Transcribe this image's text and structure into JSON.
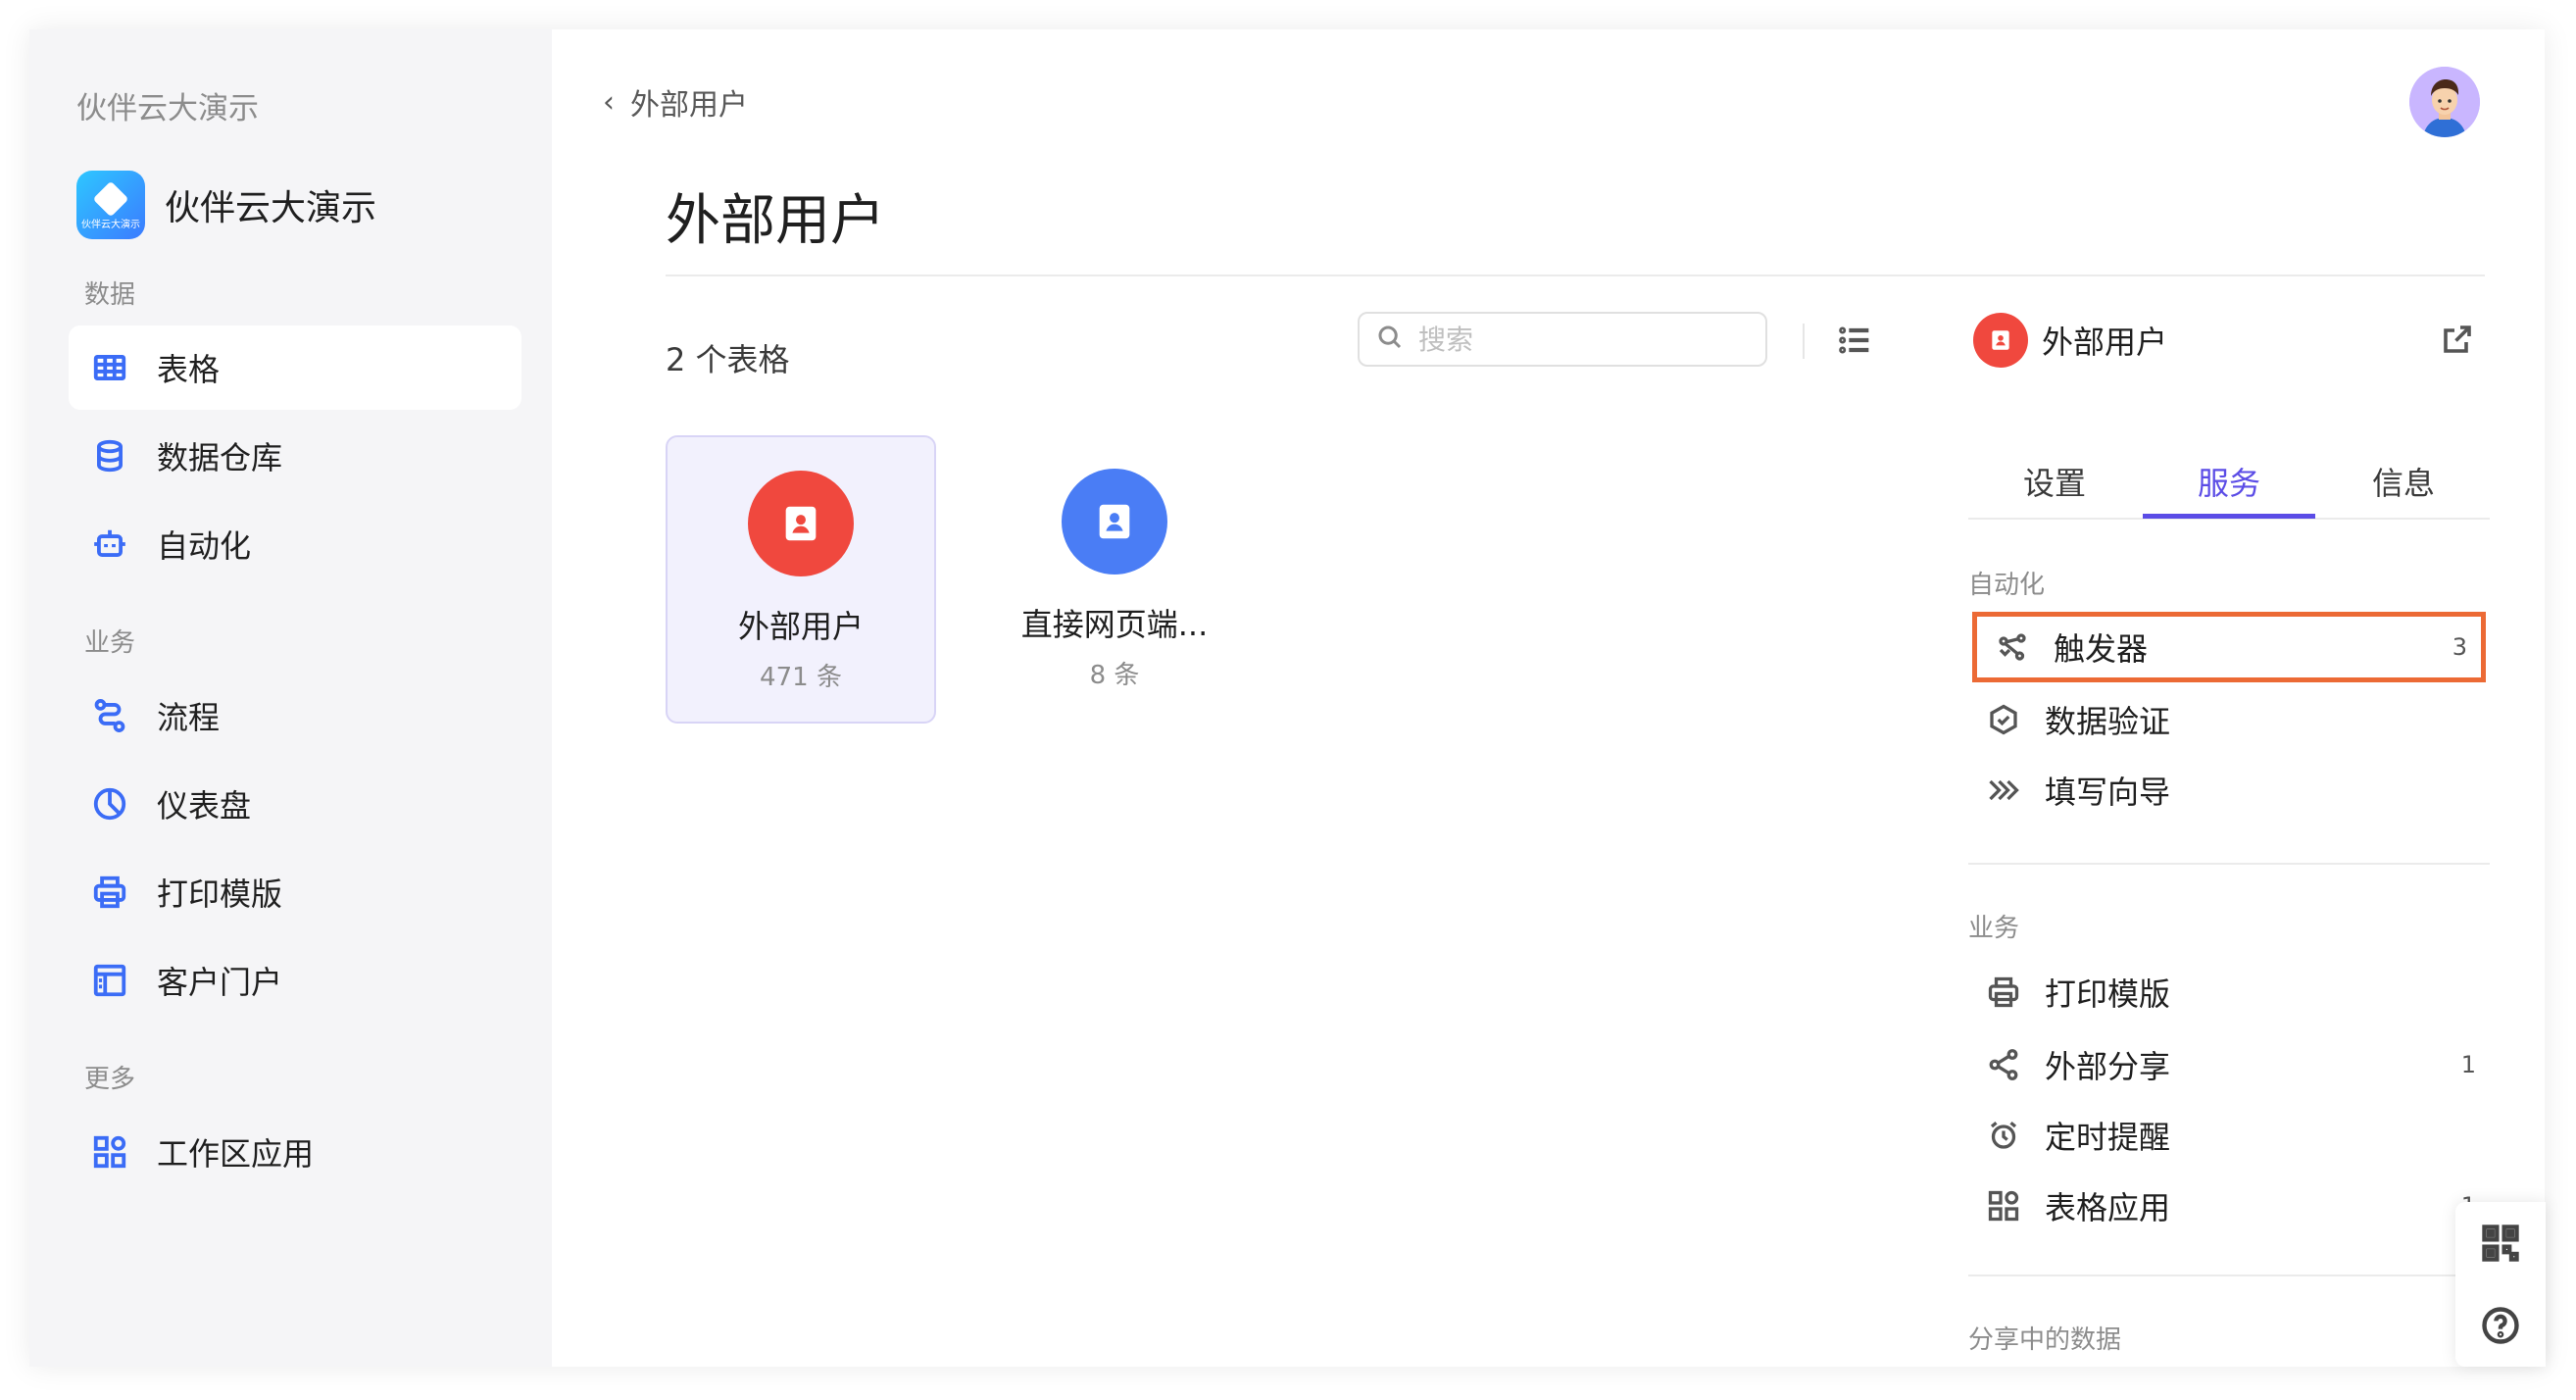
{
  "workspace_name": "伙伴云大演示",
  "app": {
    "name": "伙伴云大演示",
    "logo_text": "伙伴云大演示"
  },
  "sidebar": {
    "sections": [
      {
        "title": "数据",
        "items": [
          {
            "label": "表格",
            "icon": "table-icon",
            "active": true
          },
          {
            "label": "数据仓库",
            "icon": "database-icon"
          },
          {
            "label": "自动化",
            "icon": "robot-icon"
          }
        ]
      },
      {
        "title": "业务",
        "items": [
          {
            "label": "流程",
            "icon": "flow-icon"
          },
          {
            "label": "仪表盘",
            "icon": "pie-chart-icon"
          },
          {
            "label": "打印模版",
            "icon": "printer-icon"
          },
          {
            "label": "客户门户",
            "icon": "portal-icon"
          }
        ]
      },
      {
        "title": "更多",
        "items": [
          {
            "label": "工作区应用",
            "icon": "apps-icon"
          }
        ]
      }
    ]
  },
  "header": {
    "breadcrumb": "外部用户",
    "title": "外部用户"
  },
  "toolbar": {
    "count_label": "2 个表格",
    "search_placeholder": "搜索"
  },
  "tables": [
    {
      "name": "外部用户",
      "count": "471 条",
      "color": "#f0483e",
      "selected": true
    },
    {
      "name": "直接网页端...",
      "count": "8 条",
      "color": "#4a7df5",
      "selected": false
    }
  ],
  "panel": {
    "title": "外部用户",
    "tabs": [
      "设置",
      "服务",
      "信息"
    ],
    "active_tab": "服务",
    "automation": {
      "title": "自动化",
      "items": [
        {
          "label": "触发器",
          "count": "3",
          "icon": "trigger-icon",
          "highlighted": true
        },
        {
          "label": "数据验证",
          "count": "",
          "icon": "shield-check-icon"
        },
        {
          "label": "填写向导",
          "count": "",
          "icon": "guide-arrows-icon"
        }
      ]
    },
    "business": {
      "title": "业务",
      "items": [
        {
          "label": "打印模版",
          "count": "",
          "icon": "printer-icon"
        },
        {
          "label": "外部分享",
          "count": "1",
          "icon": "share-icon"
        },
        {
          "label": "定时提醒",
          "count": "",
          "icon": "alarm-clock-icon"
        },
        {
          "label": "表格应用",
          "count": "1",
          "icon": "apps-icon"
        }
      ]
    },
    "shared": {
      "title": "分享中的数据"
    }
  },
  "colors": {
    "accent": "#5b4ce6",
    "highlight_border": "#ec6a35",
    "icon_blue": "#3b6cf6"
  }
}
